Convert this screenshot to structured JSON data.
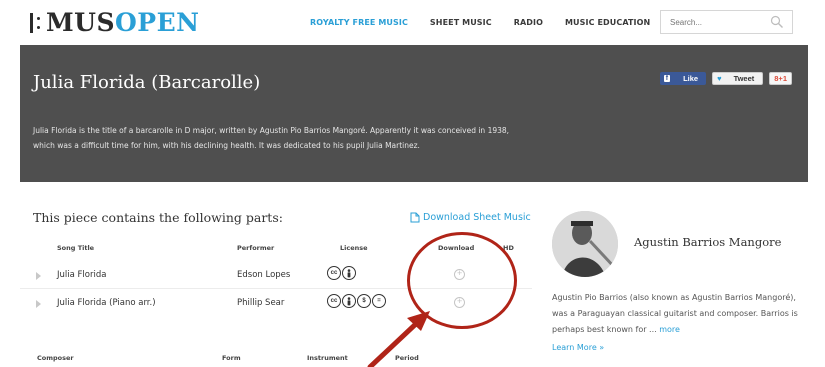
{
  "header": {
    "logo_mus": "MUS",
    "logo_open": "OPEN",
    "nav": [
      {
        "label": "ROYALTY FREE MUSIC",
        "active": true
      },
      {
        "label": "SHEET MUSIC",
        "active": false
      },
      {
        "label": "RADIO",
        "active": false
      },
      {
        "label": "MUSIC EDUCATION",
        "active": false
      }
    ],
    "search": {
      "placeholder": "Search...",
      "icon": "search-icon"
    }
  },
  "hero": {
    "title": "Julia Florida (Barcarolle)",
    "description_line1": "Julia Florida is the title of a barcarolle in D major, written by Agustin Pio Barrios Mangoré. Apparently it was conceived in 1938,",
    "description_line2": "which was a difficult time for him, with his declining health. It was dedicated to his pupil Julia Martinez.",
    "social": {
      "facebook_badge": "f",
      "facebook": "Like",
      "twitter_badge": "♥",
      "twitter": "Tweet",
      "gplus": "8+1"
    }
  },
  "parts": {
    "heading": "This piece contains the following parts:",
    "download_sheet": "Download Sheet Music",
    "columns": {
      "song": "Song Title",
      "performer": "Performer",
      "license": "License",
      "download": "Download",
      "hd": "HD"
    },
    "rows": [
      {
        "title": "Julia Florida",
        "performer": "Edson Lopes",
        "license_icons": [
          "cc",
          "by"
        ]
      },
      {
        "title": "Julia Florida (Piano arr.)",
        "performer": "Phillip Sear",
        "license_icons": [
          "cc",
          "by",
          "nc",
          "nd"
        ]
      }
    ]
  },
  "meta": {
    "composer": "Composer",
    "form": "Form",
    "instrument": "Instrument",
    "period": "Period"
  },
  "composer": {
    "name": "Agustin Barrios Mangore",
    "bio": "Agustin Pio Barrios (also known as Agustin Barrios Mangoré), was a Paraguayan classical guitarist and composer. Barrios is perhaps best known for ...",
    "more": "more",
    "learn_more": "Learn More »"
  },
  "colors": {
    "accent": "#2a9fd6",
    "hero_bg": "#4f4f4f",
    "annotation": "#b02418"
  }
}
